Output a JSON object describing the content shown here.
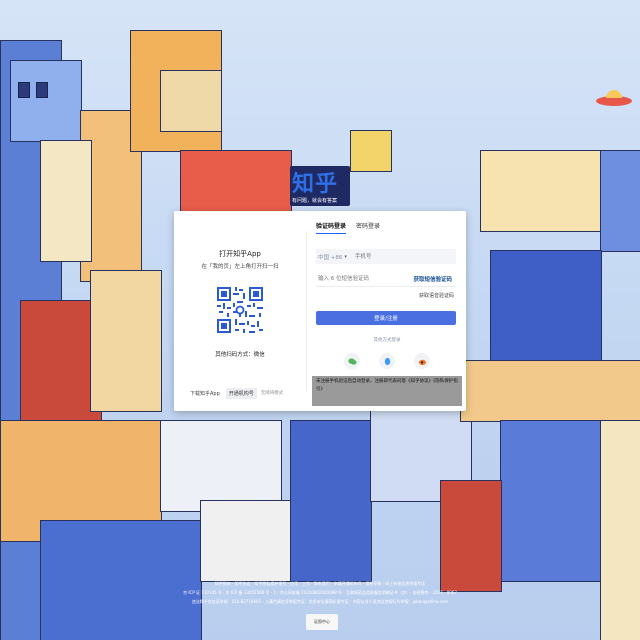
{
  "logo": {
    "mark": "知乎",
    "tagline": "有问题，就会有答案"
  },
  "qr_login": {
    "title": "打开知乎App",
    "subtitle": "在「我的页」左上角打开扫一扫",
    "other_methods": "其他扫码方式：微信",
    "download_label": "下载知乎App",
    "open_org_label": "开通机构号",
    "no_data_hint": "无障碍模式"
  },
  "form": {
    "tabs": [
      {
        "label": "验证码登录"
      },
      {
        "label": "密码登录"
      }
    ],
    "phone": {
      "country_code": "中国 +86",
      "placeholder": "手机号"
    },
    "code": {
      "placeholder": "输入 6 位短信验证码",
      "send_label": "获取短信验证码"
    },
    "voice_label": "获取语音验证码",
    "submit_label": "登录/注册",
    "other_login_label": "其他方式登录",
    "socials": [
      {
        "icon": "wechat-icon"
      },
      {
        "icon": "qq-icon"
      },
      {
        "icon": "weibo-icon"
      }
    ],
    "agreement": "未注册手机验证后自动登录，注册即代表同意《知乎协议》《隐私保护指引》"
  },
  "footer": {
    "rows": [
      "知乎指南 · 知乎协议 · 知乎隐私保护指引 · 应用 · 工作 · 联系我们 · 申请开通机构号 · 侵权举报 · 网上有害信息举报专区",
      "京 ICP 证 110745 号 · 京 ICP 备 13052560 号 - 1 · 京公网安备 11010802020088 号 · 互联网药品信息服务资格证书（京）- 非经营性 - 2017 - 0067",
      "违法和不良信息举报：010-82716601 · 儿童色情信息举报专区 · 信息安全漏洞反馈专区 · 内容从业人员违法违规行为举报：jubao@zhihu.com"
    ],
    "badge": "证照中心"
  },
  "colors": {
    "accent": "#1a66ff",
    "submit": "#4a6fe0",
    "link": "#175199"
  }
}
